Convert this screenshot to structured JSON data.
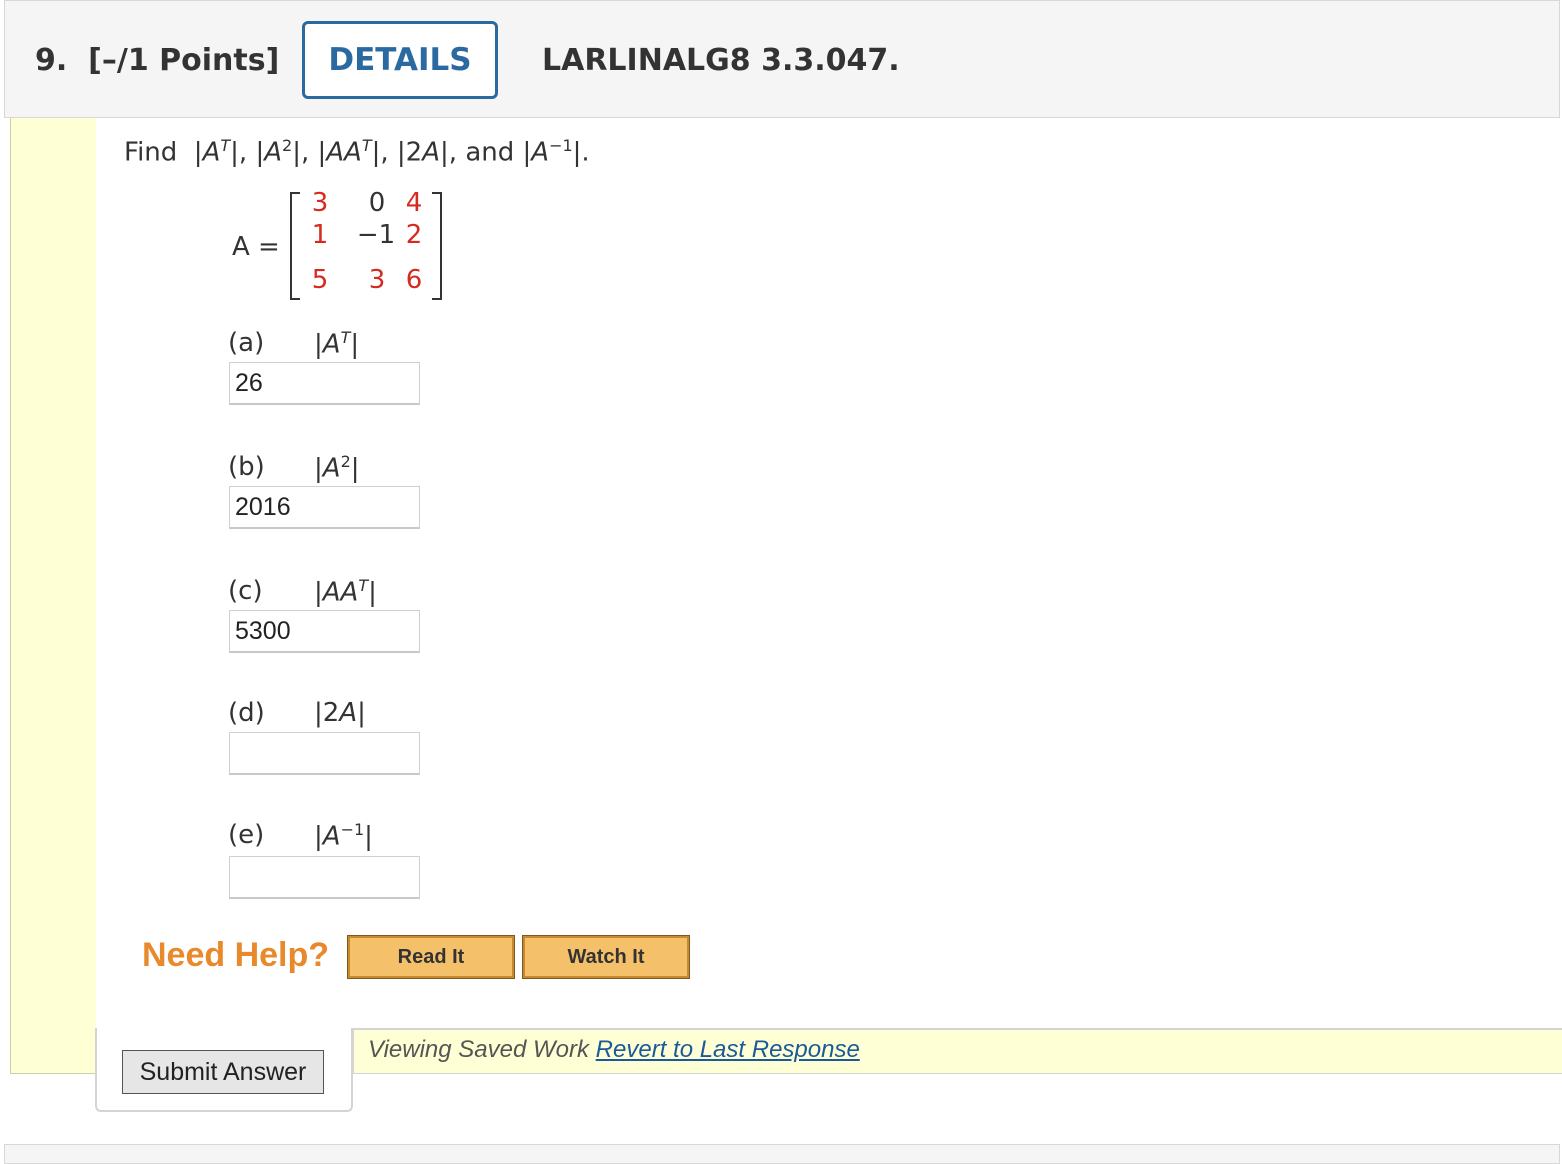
{
  "header": {
    "question_number": "9.",
    "points": "[–/1 Points]",
    "details_label": "DETAILS",
    "reference": "LARLINALG8 3.3.047."
  },
  "prompt": {
    "find": "Find",
    "and": "and"
  },
  "matrix": {
    "label": "A =",
    "rows": [
      [
        {
          "v": "3",
          "c": "red"
        },
        {
          "v": "0",
          "c": "black"
        },
        {
          "v": "4",
          "c": "red"
        }
      ],
      [
        {
          "v": "1",
          "c": "red"
        },
        {
          "v": "−1",
          "c": "black"
        },
        {
          "v": "2",
          "c": "red"
        }
      ],
      [
        {
          "v": "5",
          "c": "red"
        },
        {
          "v": "3",
          "c": "red"
        },
        {
          "v": "6",
          "c": "red"
        }
      ]
    ],
    "colors": {
      "red": "#d62a1f",
      "black": "#333333"
    }
  },
  "parts": [
    {
      "label": "(a)",
      "value": "26"
    },
    {
      "label": "(b)",
      "value": "2016"
    },
    {
      "label": "(c)",
      "value": "5300"
    },
    {
      "label": "(d)",
      "value": ""
    },
    {
      "label": "(e)",
      "value": ""
    }
  ],
  "help": {
    "title": "Need Help?",
    "read_it": "Read It",
    "watch_it": "Watch It"
  },
  "footer": {
    "submit_label": "Submit Answer",
    "saved_text": "Viewing Saved Work",
    "revert_link": "Revert to Last Response"
  }
}
